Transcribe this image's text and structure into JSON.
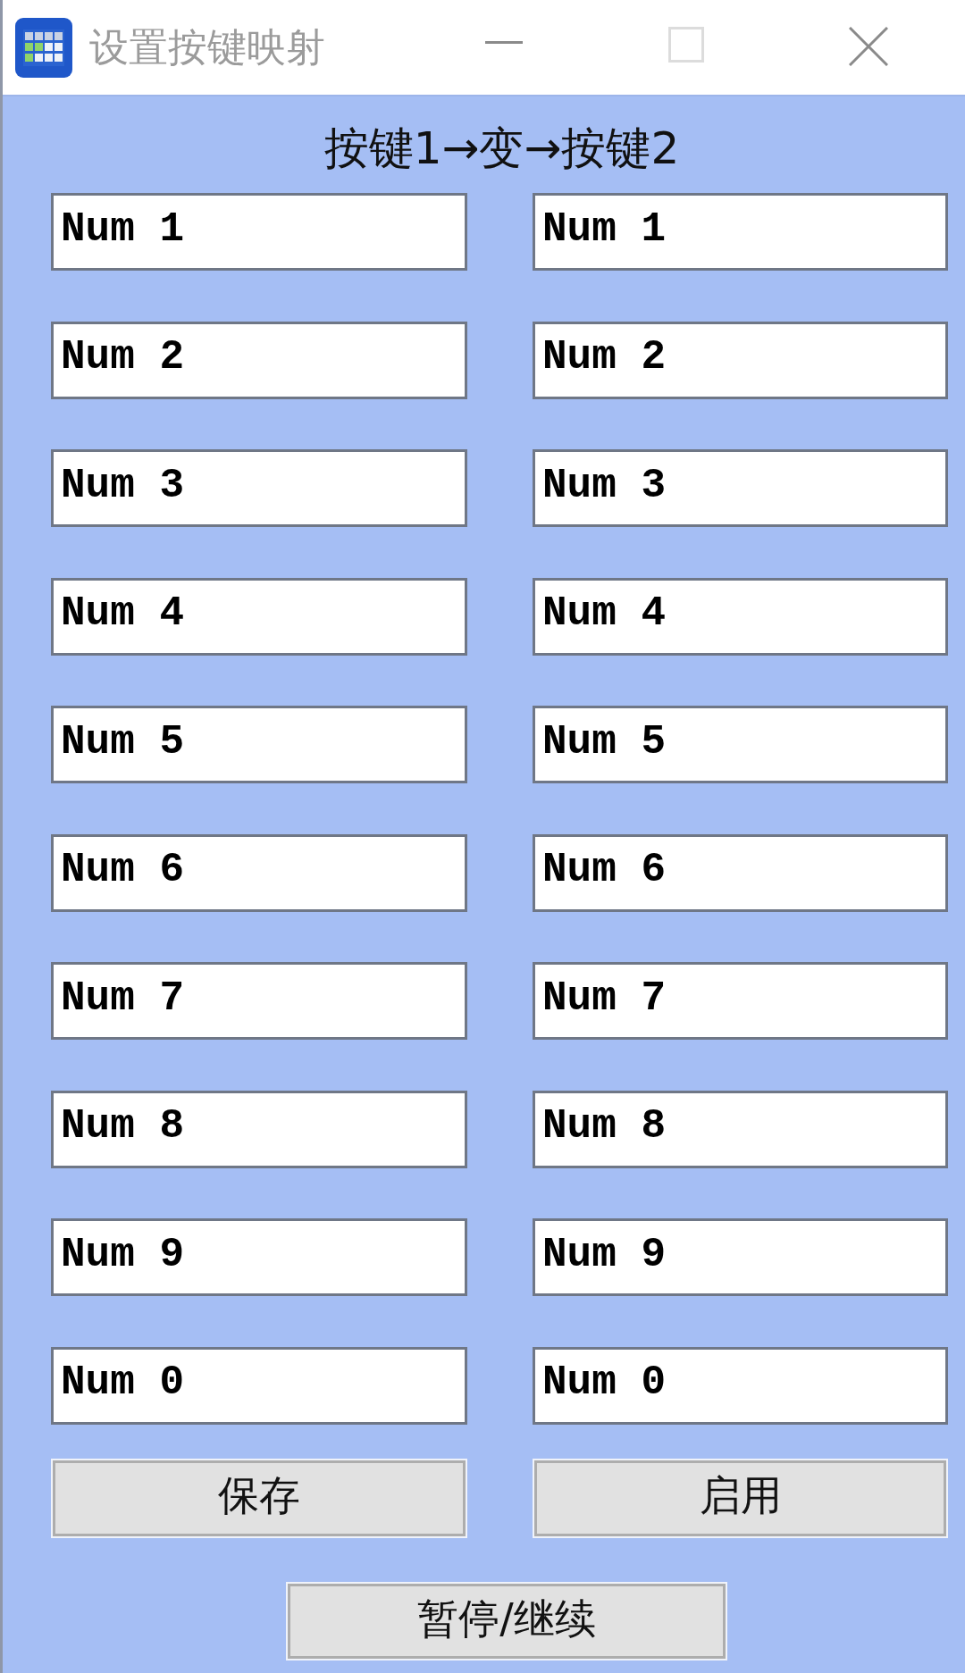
{
  "window": {
    "title": "设置按键映射"
  },
  "header": "按键1→变→按键2",
  "mappings": [
    {
      "from": "Num 1",
      "to": "Num 1"
    },
    {
      "from": "Num 2",
      "to": "Num 2"
    },
    {
      "from": "Num 3",
      "to": "Num 3"
    },
    {
      "from": "Num 4",
      "to": "Num 4"
    },
    {
      "from": "Num 5",
      "to": "Num 5"
    },
    {
      "from": "Num 6",
      "to": "Num 6"
    },
    {
      "from": "Num 7",
      "to": "Num 7"
    },
    {
      "from": "Num 8",
      "to": "Num 8"
    },
    {
      "from": "Num 9",
      "to": "Num 9"
    },
    {
      "from": "Num 0",
      "to": "Num 0"
    }
  ],
  "button_row": [
    {
      "label": "保存"
    },
    {
      "label": "启用"
    }
  ],
  "bottom_button": {
    "label": "暂停/继续"
  }
}
